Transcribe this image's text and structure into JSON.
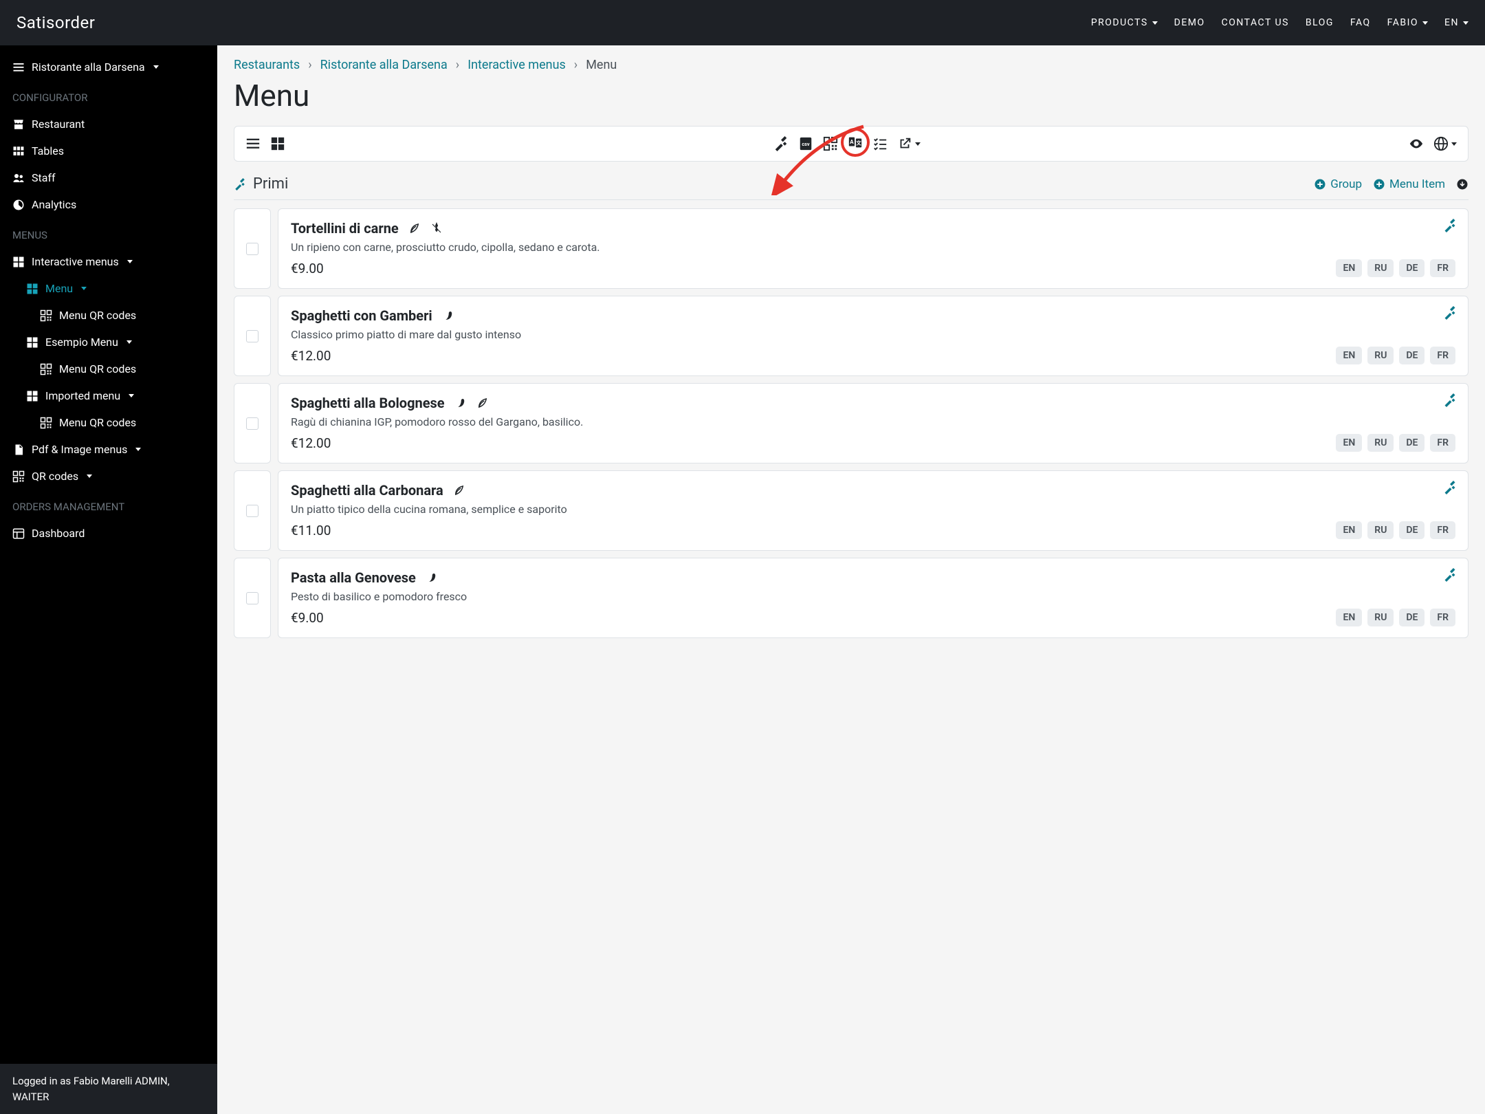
{
  "brand": "Satisorder",
  "nav": {
    "products": "PRODUCTS",
    "demo": "DEMO",
    "contact": "CONTACT US",
    "blog": "BLOG",
    "faq": "FAQ",
    "user": "FABIO",
    "lang": "EN"
  },
  "sidebar": {
    "restaurant_selector": "Ristorante alla Darsena",
    "configurator_label": "CONFIGURATOR",
    "restaurant": "Restaurant",
    "tables": "Tables",
    "staff": "Staff",
    "analytics": "Analytics",
    "menus_label": "MENUS",
    "interactive_menus": "Interactive menus",
    "menu": "Menu",
    "menu_qr1": "Menu QR codes",
    "esempio_menu": "Esempio Menu",
    "menu_qr2": "Menu QR codes",
    "imported_menu": "Imported menu",
    "menu_qr3": "Menu QR codes",
    "pdf_image_menus": "Pdf & Image menus",
    "qr_codes": "QR codes",
    "orders_label": "ORDERS MANAGEMENT",
    "dashboard": "Dashboard",
    "footer": "Logged in as Fabio Marelli  ADMIN, WAITER"
  },
  "breadcrumb": {
    "restaurants": "Restaurants",
    "restaurant": "Ristorante alla Darsena",
    "interactive_menus": "Interactive menus",
    "current": "Menu"
  },
  "page_title": "Menu",
  "section": {
    "title": "Primi",
    "group": "Group",
    "menu_item": "Menu Item"
  },
  "languages": [
    "EN",
    "RU",
    "DE",
    "FR"
  ],
  "items": [
    {
      "title": "Tortellini di carne",
      "desc": "Un ripieno con carne, prosciutto crudo, cipolla, sedano e carota.",
      "price": "€9.00",
      "icons": [
        "leaf",
        "gluten"
      ]
    },
    {
      "title": "Spaghetti con Gamberi",
      "desc": "Classico primo piatto di mare dal gusto intenso",
      "price": "€12.00",
      "icons": [
        "pepper"
      ]
    },
    {
      "title": "Spaghetti alla Bolognese",
      "desc": "Ragù di chianina IGP, pomodoro rosso del Gargano, basilico.",
      "price": "€12.00",
      "icons": [
        "pepper",
        "leaf"
      ]
    },
    {
      "title": "Spaghetti alla Carbonara",
      "desc": "Un piatto tipico della cucina romana, semplice e saporito",
      "price": "€11.00",
      "icons": [
        "leaf"
      ]
    },
    {
      "title": "Pasta alla Genovese",
      "desc": "Pesto di basilico e pomodoro fresco",
      "price": "€9.00",
      "icons": [
        "pepper"
      ]
    }
  ]
}
